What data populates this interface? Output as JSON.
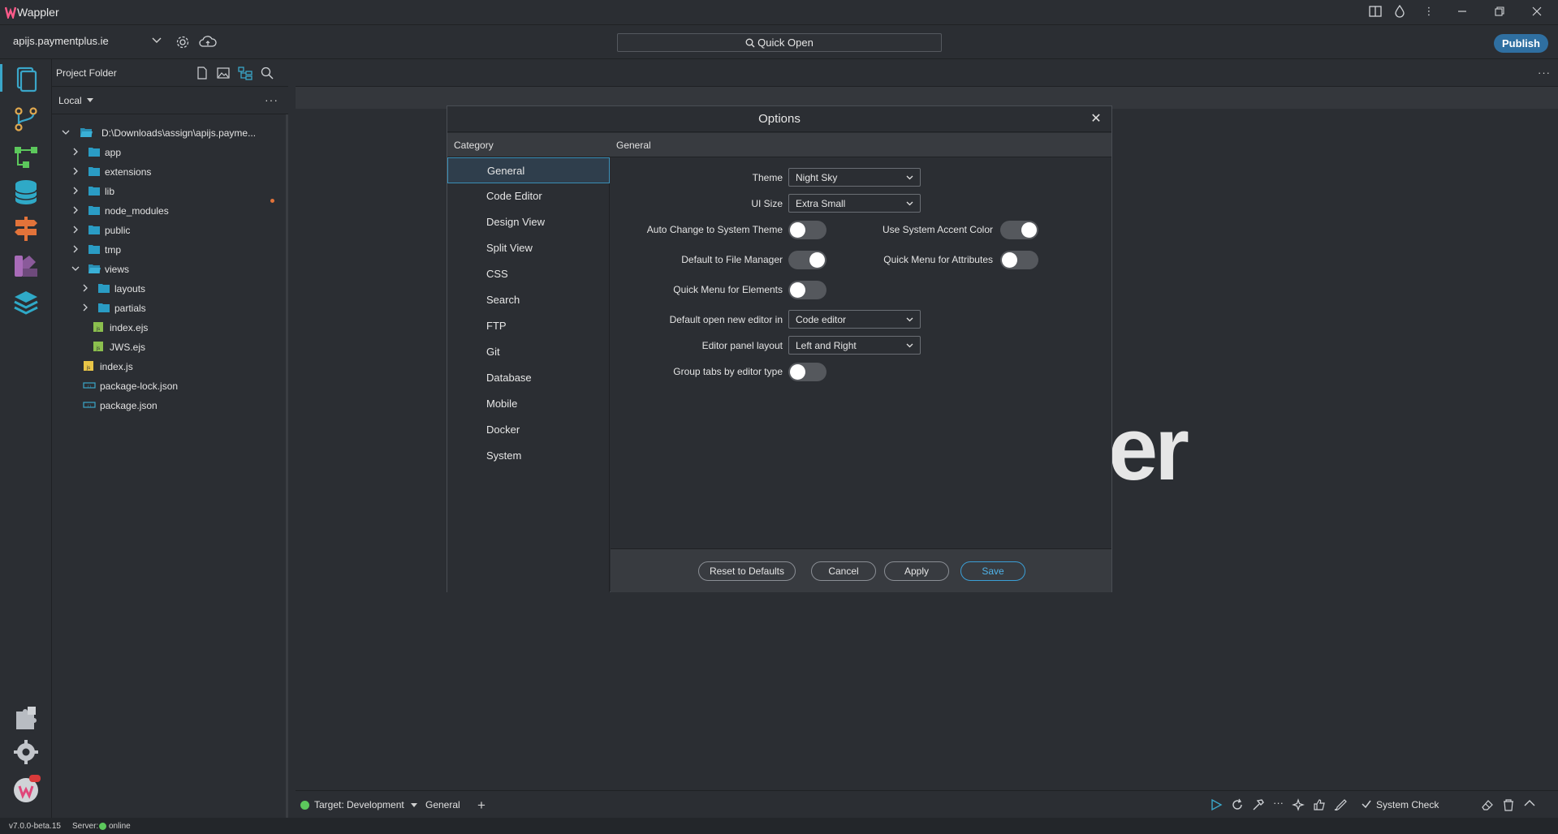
{
  "app": {
    "name": "Wappler"
  },
  "toolbar": {
    "project": "apijs.paymentplus.ie",
    "quick_open": "Quick Open",
    "publish": "Publish"
  },
  "sidebar": {
    "title": "Project Folder",
    "location": "Local",
    "root_path": "D:\\Downloads\\assign\\apijs.payme...",
    "tree": [
      {
        "label": "app",
        "type": "folder"
      },
      {
        "label": "extensions",
        "type": "folder"
      },
      {
        "label": "lib",
        "type": "folder"
      },
      {
        "label": "node_modules",
        "type": "folder"
      },
      {
        "label": "public",
        "type": "folder"
      },
      {
        "label": "tmp",
        "type": "folder"
      },
      {
        "label": "views",
        "type": "folder-open"
      },
      {
        "label": "layouts",
        "type": "folder"
      },
      {
        "label": "partials",
        "type": "folder"
      },
      {
        "label": "index.ejs",
        "type": "ejs"
      },
      {
        "label": "JWS.ejs",
        "type": "ejs"
      },
      {
        "label": "index.js",
        "type": "js"
      },
      {
        "label": "package-lock.json",
        "type": "json"
      },
      {
        "label": "package.json",
        "type": "json"
      }
    ]
  },
  "editor": {
    "background_logo": "er"
  },
  "dialog": {
    "title": "Options",
    "category_header": "Category",
    "section_header": "General",
    "categories": [
      "General",
      "Code Editor",
      "Design View",
      "Split View",
      "CSS",
      "Search",
      "FTP",
      "Git",
      "Database",
      "Mobile",
      "Docker",
      "System"
    ],
    "active_category": "General",
    "fields": {
      "theme_label": "Theme",
      "theme_value": "Night Sky",
      "ui_size_label": "UI Size",
      "ui_size_value": "Extra Small",
      "auto_change_label": "Auto Change to System Theme",
      "auto_change_on": false,
      "accent_label": "Use System Accent Color",
      "accent_on": true,
      "file_manager_label": "Default to File Manager",
      "file_manager_on": true,
      "quick_menu_attr_label": "Quick Menu for Attributes",
      "quick_menu_attr_on": false,
      "quick_menu_el_label": "Quick Menu for Elements",
      "quick_menu_el_on": false,
      "open_editor_label": "Default open new editor in",
      "open_editor_value": "Code editor",
      "panel_layout_label": "Editor panel layout",
      "panel_layout_value": "Left and Right",
      "group_tabs_label": "Group tabs by editor type",
      "group_tabs_on": false
    },
    "buttons": {
      "reset": "Reset to Defaults",
      "cancel": "Cancel",
      "apply": "Apply",
      "save": "Save"
    }
  },
  "bottombar": {
    "target": "Target: Development",
    "general": "General",
    "system_check": "System Check"
  },
  "statusbar": {
    "version": "v7.0.0-beta.15",
    "server_label": "Server:",
    "server_status": "online"
  },
  "colors": {
    "accent": "#2f6fa1",
    "online": "#5cc85c",
    "icon_teal": "#3aa6c9"
  }
}
